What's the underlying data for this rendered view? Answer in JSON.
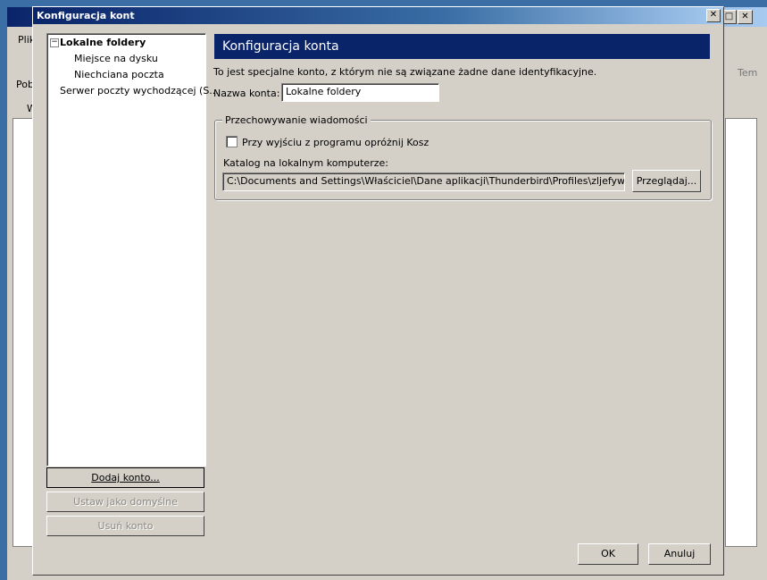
{
  "background": {
    "menu_label": "Plik",
    "toolbar_label": "Pob",
    "side_label": "W",
    "search_label": "Tem"
  },
  "dialog": {
    "title": "Konfiguracja kont",
    "close_icon": "close-icon"
  },
  "tree": {
    "items": [
      {
        "label": "Lokalne foldery",
        "bold": true
      },
      {
        "label": "Miejsce na dysku"
      },
      {
        "label": "Niechciana poczta"
      },
      {
        "label": "Serwer poczty wychodzącej (S..."
      }
    ]
  },
  "left_buttons": {
    "add": "Dodaj konto...",
    "set_default": "Ustaw jako domyślne",
    "remove": "Usuń konto"
  },
  "panel": {
    "header": "Konfiguracja konta",
    "description": "To jest specjalne konto, z którym nie są związane żadne dane identyfikacyjne.",
    "name_label": "Nazwa konta:",
    "name_value": "Lokalne foldery",
    "group_title": "Przechowywanie wiadomości",
    "empty_trash_label": "Przy wyjściu z programu opróżnij Kosz",
    "empty_trash_checked": false,
    "dir_label": "Katalog na lokalnym komputerze:",
    "dir_value": "C:\\Documents and Settings\\Właściciel\\Dane aplikacji\\Thunderbird\\Profiles\\zljefywb.default\\M",
    "browse": "Przeglądaj..."
  },
  "footer": {
    "ok": "OK",
    "cancel": "Anuluj"
  },
  "colors": {
    "header_bg": "#0a246a",
    "dialog_bg": "#d4d0c8"
  }
}
